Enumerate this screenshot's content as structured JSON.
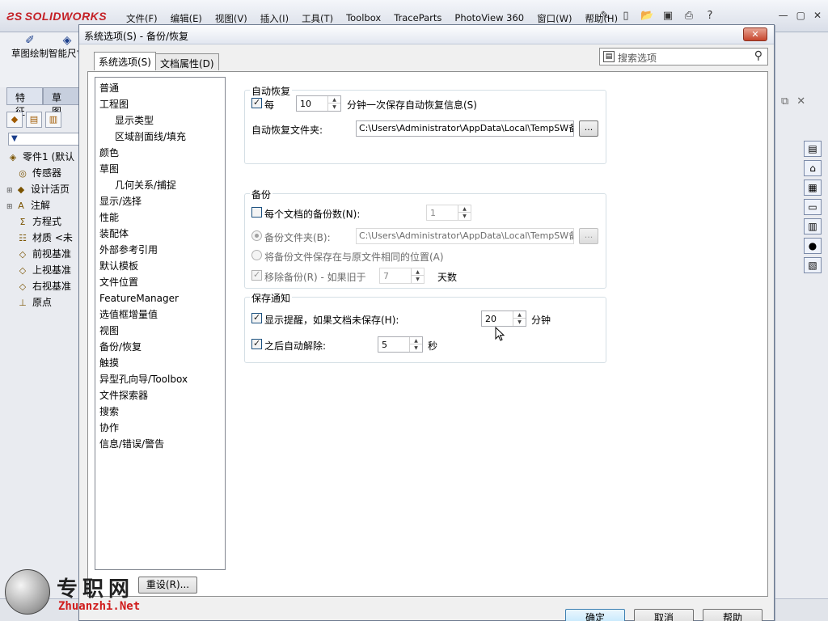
{
  "app": {
    "logo": "SOLIDWORKS",
    "menu": [
      "文件(F)",
      "编辑(E)",
      "视图(V)",
      "插入(I)",
      "工具(T)",
      "Toolbox",
      "TraceParts",
      "PhotoView 360",
      "窗口(W)",
      "帮助(H)"
    ]
  },
  "command_bar": {
    "sketch": "草图绘制",
    "smart_dim": "智能尺寸"
  },
  "left_tabs": [
    "特征",
    "草图"
  ],
  "feature_tree": [
    {
      "label": "零件1 (默认",
      "icon": "part-icon"
    },
    {
      "label": "传感器",
      "icon": "sensor-icon"
    },
    {
      "label": "设计活页",
      "icon": "design-binder-icon"
    },
    {
      "label": "注解",
      "icon": "annotation-icon"
    },
    {
      "label": "方程式",
      "icon": "equation-icon"
    },
    {
      "label": "材质 <未",
      "icon": "material-icon"
    },
    {
      "label": "前视基准",
      "icon": "plane-icon"
    },
    {
      "label": "上视基准",
      "icon": "plane-icon"
    },
    {
      "label": "右视基准",
      "icon": "plane-icon"
    },
    {
      "label": "原点",
      "icon": "origin-icon"
    }
  ],
  "dialog": {
    "title": "系统选项(S) - 备份/恢复",
    "close": "✕",
    "tabs": [
      "系统选项(S)",
      "文档属性(D)"
    ],
    "search_placeholder": "搜索选项",
    "option_list": [
      {
        "label": "普通",
        "sub": false
      },
      {
        "label": "工程图",
        "sub": false
      },
      {
        "label": "显示类型",
        "sub": true
      },
      {
        "label": "区域剖面线/填充",
        "sub": true
      },
      {
        "label": "颜色",
        "sub": false
      },
      {
        "label": "草图",
        "sub": false
      },
      {
        "label": "几何关系/捕捉",
        "sub": true
      },
      {
        "label": "显示/选择",
        "sub": false
      },
      {
        "label": "性能",
        "sub": false
      },
      {
        "label": "装配体",
        "sub": false
      },
      {
        "label": "外部参考引用",
        "sub": false
      },
      {
        "label": "默认模板",
        "sub": false
      },
      {
        "label": "文件位置",
        "sub": false
      },
      {
        "label": "FeatureManager",
        "sub": false
      },
      {
        "label": "选值框增量值",
        "sub": false
      },
      {
        "label": "视图",
        "sub": false
      },
      {
        "label": "备份/恢复",
        "sub": false
      },
      {
        "label": "触摸",
        "sub": false
      },
      {
        "label": "异型孔向导/Toolbox",
        "sub": false
      },
      {
        "label": "文件探索器",
        "sub": false
      },
      {
        "label": "搜索",
        "sub": false
      },
      {
        "label": "协作",
        "sub": false
      },
      {
        "label": "信息/错误/警告",
        "sub": false
      }
    ],
    "reset_button": "重设(R)...",
    "autorecover": {
      "title": "自动恢复",
      "every_label": "每",
      "every_checked": true,
      "minutes_value": "10",
      "minutes_suffix": "分钟一次保存自动恢复信息(S)",
      "folder_label": "自动恢复文件夹:",
      "folder_value": "C:\\Users\\Administrator\\AppData\\Local\\TempSW备份目",
      "browse": "..."
    },
    "backup": {
      "title": "备份",
      "copies_label": "每个文档的备份数(N):",
      "copies_checked": false,
      "copies_value": "1",
      "folder_radio_label": "备份文件夹(B):",
      "folder_value": "C:\\Users\\Administrator\\AppData\\Local\\TempSW备份目",
      "browse": "...",
      "same_location_label": "将备份文件保存在与原文件相同的位置(A)",
      "remove_label": "移除备份(R) - 如果旧于",
      "remove_value": "7",
      "remove_unit": "天数"
    },
    "save_notification": {
      "title": "保存通知",
      "remind_label": "显示提醒，如果文档未保存(H):",
      "remind_checked": true,
      "remind_value": "20",
      "remind_unit": "分钟",
      "dismiss_label": "之后自动解除:",
      "dismiss_checked": true,
      "dismiss_value": "5",
      "dismiss_unit": "秒"
    },
    "buttons": {
      "ok": "确定",
      "cancel": "取消",
      "help": "帮助"
    }
  },
  "watermark": {
    "cn": "专职网",
    "en": "Zhuanzhi.Net"
  }
}
